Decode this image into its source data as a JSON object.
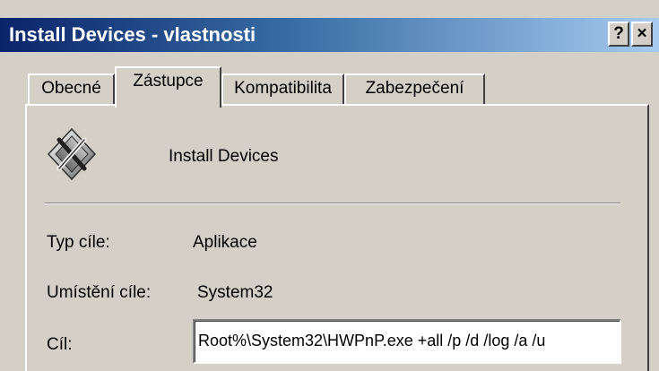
{
  "window": {
    "title": "Install Devices - vlastnosti",
    "help_label": "?",
    "close_label": "×"
  },
  "tabs": [
    {
      "label": "Obecné",
      "active": false
    },
    {
      "label": "Zástupce",
      "active": true
    },
    {
      "label": "Kompatibilita",
      "active": false
    },
    {
      "label": "Zabezpečení",
      "active": false
    }
  ],
  "shortcut": {
    "icon": "install-devices-icon",
    "name": "Install Devices",
    "fields": {
      "type_label": "Typ cíle:",
      "type_value": "Aplikace",
      "location_label": "Umístění cíle:",
      "location_value": "System32",
      "target_label": "Cíl:",
      "target_value": "Root%\\System32\\HWPnP.exe +all /p /d /log /a /u"
    }
  },
  "colors": {
    "face": "#d4d0c8",
    "title_start": "#0a246a",
    "title_end": "#a6caf0",
    "title_text": "#ffffff"
  }
}
